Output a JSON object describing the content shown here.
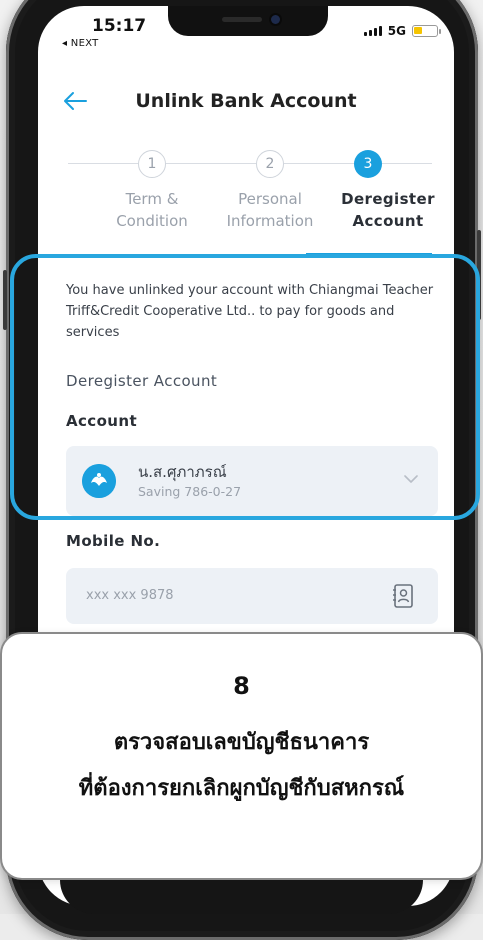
{
  "status_bar": {
    "time": "15:17",
    "back_app": "◂ NEXT",
    "network": "5G"
  },
  "header": {
    "title": "Unlink Bank Account"
  },
  "steps": [
    {
      "number": "1",
      "label_line1": "Term &",
      "label_line2": "Condition",
      "active": false
    },
    {
      "number": "2",
      "label_line1": "Personal",
      "label_line2": "Information",
      "active": false
    },
    {
      "number": "3",
      "label_line1": "Deregister",
      "label_line2": "Account",
      "active": true
    }
  ],
  "content": {
    "info_text": "You have unlinked your account with Chiangmai Teacher Triff&Credit Cooperative Ltd.. to pay for goods and services",
    "section_title": "Deregister Account",
    "account_label": "Account",
    "account_name": "น.ส.ศุภาภรณ์",
    "account_sub": "Saving 786-0-27",
    "mobile_label": "Mobile No.",
    "mobile_value": "xxx xxx 9878"
  },
  "overlay": {
    "number": "8",
    "line1": "ตรวจสอบเลขบัญชีธนาคาร",
    "line2": "ที่ต้องการยกเลิกผูกบัญชีกับสหกรณ์"
  },
  "colors": {
    "accent": "#1aa0de",
    "highlight": "#29a7df",
    "field_bg": "#edf1f6",
    "battery": "#f5c400"
  },
  "icons": [
    "back-arrow-icon",
    "bank-logo-icon",
    "chevron-down-icon",
    "contact-book-icon",
    "signal-icon",
    "battery-icon"
  ]
}
